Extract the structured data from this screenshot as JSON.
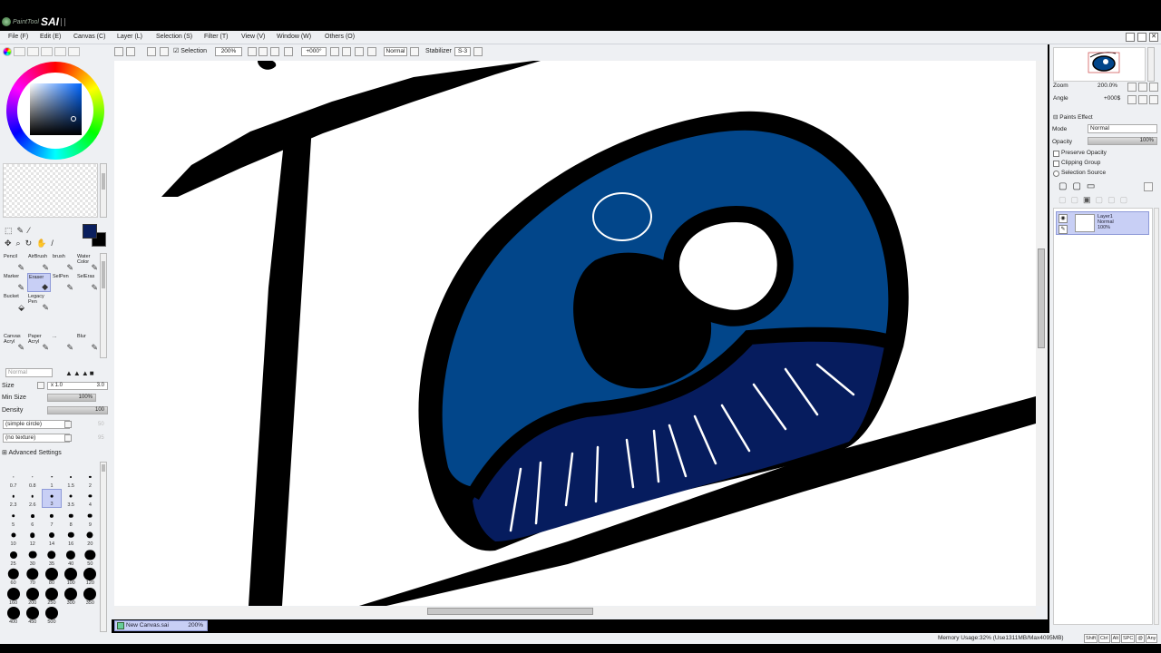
{
  "app": {
    "name": "SAI",
    "brand": "PaintTool"
  },
  "menu": [
    "File (F)",
    "Edit (E)",
    "Canvas (C)",
    "Layer (L)",
    "Selection (S)",
    "Filter (T)",
    "View (V)",
    "Window (W)",
    "Others (O)"
  ],
  "toolbar": {
    "selection_label": "Selection",
    "zoom": "200%",
    "angle": "+000°",
    "blend": "Normal",
    "stabilizer_label": "Stabilizer",
    "stabilizer_value": "S-3"
  },
  "tools": [
    {
      "label": "Pencil",
      "icon": "pencil-icon"
    },
    {
      "label": "AirBrush",
      "icon": "airbrush-icon"
    },
    {
      "label": "brush",
      "icon": "brush-icon"
    },
    {
      "label": "Water Color",
      "icon": "watercolor-icon"
    },
    {
      "label": "Marker",
      "icon": "marker-icon"
    },
    {
      "label": "Eraser",
      "icon": "eraser-icon",
      "selected": true
    },
    {
      "label": "SelPen",
      "icon": "selpen-icon"
    },
    {
      "label": "SelEras",
      "icon": "seleraser-icon"
    },
    {
      "label": "Bucket",
      "icon": "bucket-icon"
    },
    {
      "label": "Legacy Pen",
      "icon": "legacy-pen-icon"
    },
    {
      "label": "",
      "icon": ""
    },
    {
      "label": "",
      "icon": ""
    },
    {
      "label": "",
      "icon": ""
    },
    {
      "label": "",
      "icon": ""
    },
    {
      "label": "",
      "icon": ""
    },
    {
      "label": "",
      "icon": ""
    },
    {
      "label": "Canvas Acryl",
      "icon": "canvas-acryl-icon"
    },
    {
      "label": "Paper Acryl",
      "icon": "paper-acryl-icon"
    },
    {
      "label": "...",
      "icon": "brush-icon"
    },
    {
      "label": "Blur",
      "icon": "blur-icon"
    }
  ],
  "brush_props": {
    "mode": "Normal",
    "size_label": "Size",
    "size_mult": "x 1.0",
    "size_value": "3.0",
    "min_size_label": "Min Size",
    "min_size_value": "100%",
    "density_label": "Density",
    "density_value": "100",
    "shape": "(simple circle)",
    "shape_value": "50",
    "texture": "(no texture)",
    "texture_value": "95",
    "advanced": "Advanced Settings"
  },
  "brush_sizes": [
    "0.7",
    "0.8",
    "1",
    "1.5",
    "2",
    "2.3",
    "2.6",
    "3",
    "3.5",
    "4",
    "5",
    "6",
    "7",
    "8",
    "9",
    "10",
    "12",
    "14",
    "16",
    "20",
    "25",
    "30",
    "35",
    "40",
    "50",
    "60",
    "70",
    "80",
    "100",
    "120",
    "160",
    "200",
    "250",
    "300",
    "350",
    "400",
    "450",
    "500"
  ],
  "selected_brush_size": "3",
  "document_tab": {
    "name": "New Canvas.sai",
    "zoom": "200%"
  },
  "navigator": {
    "zoom_label": "Zoom",
    "zoom_value": "200.0%",
    "angle_label": "Angle",
    "angle_value": "+000$"
  },
  "layer_props": {
    "paints_effect": "Paints Effect",
    "mode_label": "Mode",
    "mode_value": "Normal",
    "opacity_label": "Opacity",
    "opacity_value": "100%",
    "preserve_opacity": "Preserve Opacity",
    "clipping_group": "Clipping Group",
    "selection_source": "Selection Source"
  },
  "layers": [
    {
      "name": "Layer1",
      "mode": "Normal",
      "opacity": "100%"
    }
  ],
  "status": {
    "memory": "Memory Usage:32% (Use1311MB/Max4095MB)",
    "keys": [
      "Shift",
      "Ctrl",
      "Alt",
      "SPC",
      "@",
      "Any"
    ]
  },
  "colors": {
    "foreground": "#0a1f5e",
    "background": "#000000",
    "iris": "#02468a",
    "iris_shadow": "#061c5e",
    "selection_accent": "#c8cff5"
  }
}
